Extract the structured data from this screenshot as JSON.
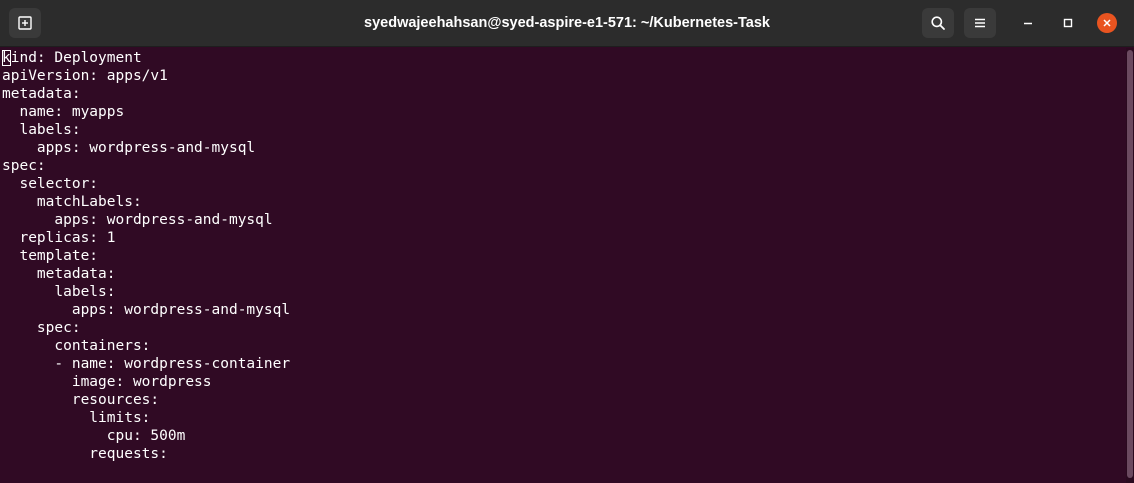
{
  "window": {
    "title": "syedwajeehahsan@syed-aspire-e1-571: ~/Kubernetes-Task"
  },
  "icons": {
    "new_tab": "new-tab-icon",
    "search": "search-icon",
    "menu": "hamburger-menu-icon",
    "minimize": "minimize-icon",
    "maximize": "maximize-icon",
    "close": "close-icon"
  },
  "colors": {
    "terminal_bg": "#300a24",
    "titlebar_bg": "#2c2c2c",
    "close_accent": "#e95420",
    "text": "#ffffff"
  },
  "terminal": {
    "cursor_char": "k",
    "lines": [
      "kind: Deployment",
      "apiVersion: apps/v1",
      "metadata:",
      "  name: myapps",
      "  labels:",
      "    apps: wordpress-and-mysql",
      "spec:",
      "  selector:",
      "    matchLabels:",
      "      apps: wordpress-and-mysql",
      "  replicas: 1",
      "  template:",
      "    metadata:",
      "      labels:",
      "        apps: wordpress-and-mysql",
      "    spec:",
      "      containers:",
      "      - name: wordpress-container",
      "        image: wordpress",
      "        resources:",
      "          limits:",
      "            cpu: 500m",
      "          requests:"
    ]
  }
}
